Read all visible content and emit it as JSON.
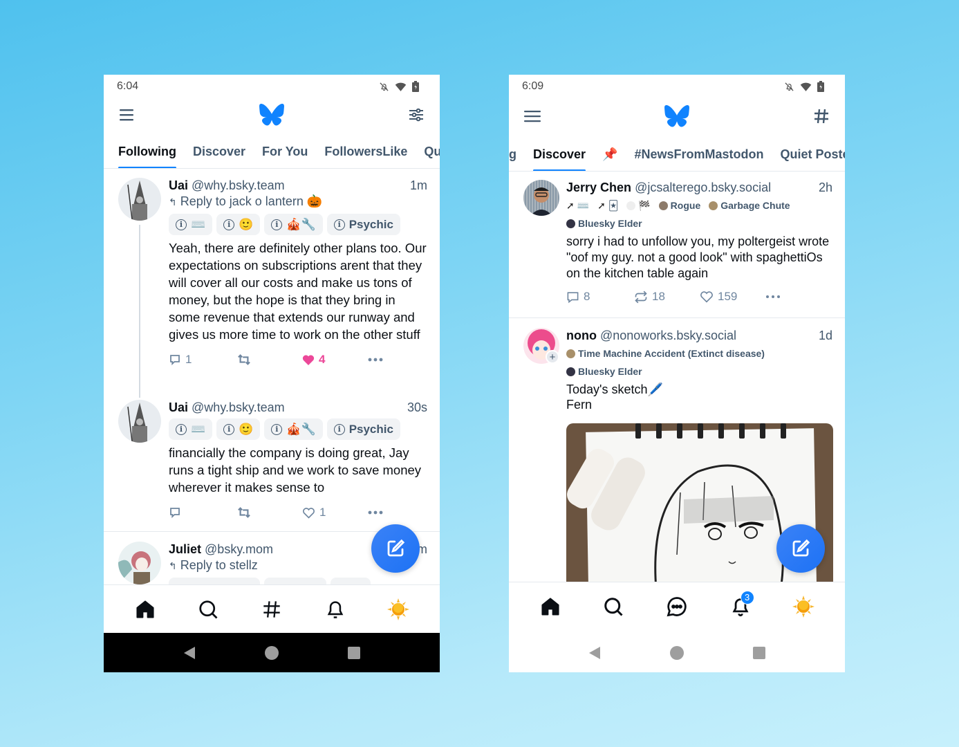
{
  "left_phone": {
    "status": {
      "time": "6:04"
    },
    "header": {
      "logo": "butterfly-logo",
      "left_icon": "menu-icon",
      "right_icon": "sliders-icon"
    },
    "tabs": [
      {
        "label": "Following",
        "active": true
      },
      {
        "label": "Discover",
        "active": false
      },
      {
        "label": "For You",
        "active": false
      },
      {
        "label": "FollowersLike",
        "active": false
      },
      {
        "label": "Qu",
        "active": false
      }
    ],
    "posts": [
      {
        "name": "Uai",
        "handle": "@why.bsky.team",
        "time": "1m",
        "reply_to": "Reply to jack o lantern 🎃",
        "badges": [
          "⌨️",
          "🙂",
          "🎪🔧",
          "Psychic"
        ],
        "text": "Yeah, there are definitely other plans too. Our expectations on subscriptions arent that they will cover all our costs and make us tons of money, but the hope is that they bring in some revenue that extends our runway and gives us more time to work on the other stuff",
        "replies": "1",
        "reposts": "",
        "likes": "4",
        "liked": true
      },
      {
        "name": "Uai",
        "handle": "@why.bsky.team",
        "time": "30s",
        "badges": [
          "⌨️",
          "🙂",
          "🎪🔧",
          "Psychic"
        ],
        "text": "financially the company is doing great, Jay runs a tight ship and we work to save money wherever it makes sense to",
        "replies": "",
        "reposts": "",
        "likes": "1",
        "liked": false
      },
      {
        "name": "Juliet",
        "handle": "@bsky.mom",
        "time": "1m",
        "reply_to": "Reply to stellz"
      }
    ],
    "bottom_nav": [
      "home-icon",
      "search-icon",
      "hashtag-icon",
      "bell-icon",
      "sun-avatar"
    ],
    "accent": "#1083fe",
    "like_color": "#ec4899"
  },
  "right_phone": {
    "status": {
      "time": "6:09"
    },
    "header": {
      "logo": "butterfly-logo",
      "left_icon": "menu-icon",
      "right_icon": "hashtag-icon"
    },
    "tabs": [
      {
        "label": "g",
        "active": false
      },
      {
        "label": "Discover",
        "active": true
      },
      {
        "label": "📌",
        "active": false
      },
      {
        "label": "#NewsFromMastodon",
        "active": false
      },
      {
        "label": "Quiet Poster",
        "active": false
      }
    ],
    "posts": [
      {
        "name": "Jerry Chen",
        "handle": "@jcsalterego.bsky.social",
        "time": "2h",
        "badges_row1": [
          "⌨️",
          "🃏",
          "🏁",
          "Rogue",
          "Garbage Chute"
        ],
        "badges_row2": [
          "Bluesky Elder"
        ],
        "text": "sorry i had to unfollow you, my poltergeist wrote \"oof my guy. not a good look\" with spaghettiOs on the kitchen table again",
        "replies": "8",
        "reposts": "18",
        "likes": "159"
      },
      {
        "name": "nono",
        "handle": "@nonoworks.bsky.social",
        "time": "1d",
        "badges_row1": [
          "Time Machine Accident (Extinct disease)"
        ],
        "badges_row2": [
          "Bluesky Elder"
        ],
        "text_line1": "Today's sketch🖊️",
        "text_line2": "Fern",
        "image": "anime-sketch-photo"
      }
    ],
    "bottom_nav": [
      "home-icon",
      "search-icon",
      "chat-icon",
      "bell-icon",
      "sun-avatar"
    ],
    "notification_count": "3"
  }
}
